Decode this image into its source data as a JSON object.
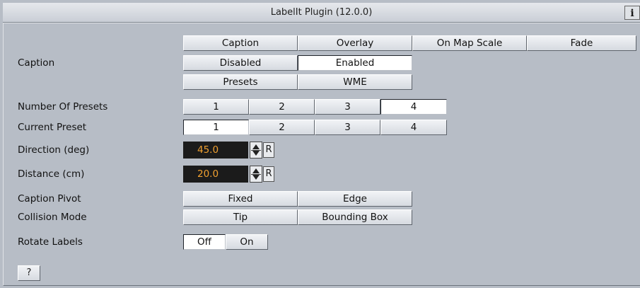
{
  "window": {
    "title": "LabelIt Plugin (12.0.0)",
    "info_label": "i"
  },
  "tabs": [
    "Caption",
    "Overlay",
    "On Map Scale",
    "Fade"
  ],
  "caption": {
    "label": "Caption",
    "options": [
      "Disabled",
      "Enabled"
    ],
    "selected": "Enabled"
  },
  "source": {
    "options": [
      "Presets",
      "WME"
    ],
    "selected": "WME"
  },
  "number_of_presets": {
    "label": "Number Of Presets",
    "options": [
      "1",
      "2",
      "3",
      "4"
    ],
    "selected": "4"
  },
  "current_preset": {
    "label": "Current Preset",
    "options": [
      "1",
      "2",
      "3",
      "4"
    ],
    "selected": "1"
  },
  "direction": {
    "label": "Direction (deg)",
    "value": "45.0",
    "reset_label": "R"
  },
  "distance": {
    "label": "Distance (cm)",
    "value": "20.0",
    "reset_label": "R"
  },
  "caption_pivot": {
    "label": "Caption Pivot",
    "options": [
      "Fixed",
      "Edge"
    ],
    "selected": "Edge"
  },
  "collision_mode": {
    "label": "Collision Mode",
    "options": [
      "Tip",
      "Bounding Box"
    ],
    "selected": "Bounding Box"
  },
  "rotate_labels": {
    "label": "Rotate Labels",
    "options": [
      "Off",
      "On"
    ],
    "selected": "On"
  },
  "help_label": "?",
  "colors": {
    "background": "#b7bdc6",
    "value_text": "#f0a030",
    "value_bg": "#1b1b1b"
  }
}
